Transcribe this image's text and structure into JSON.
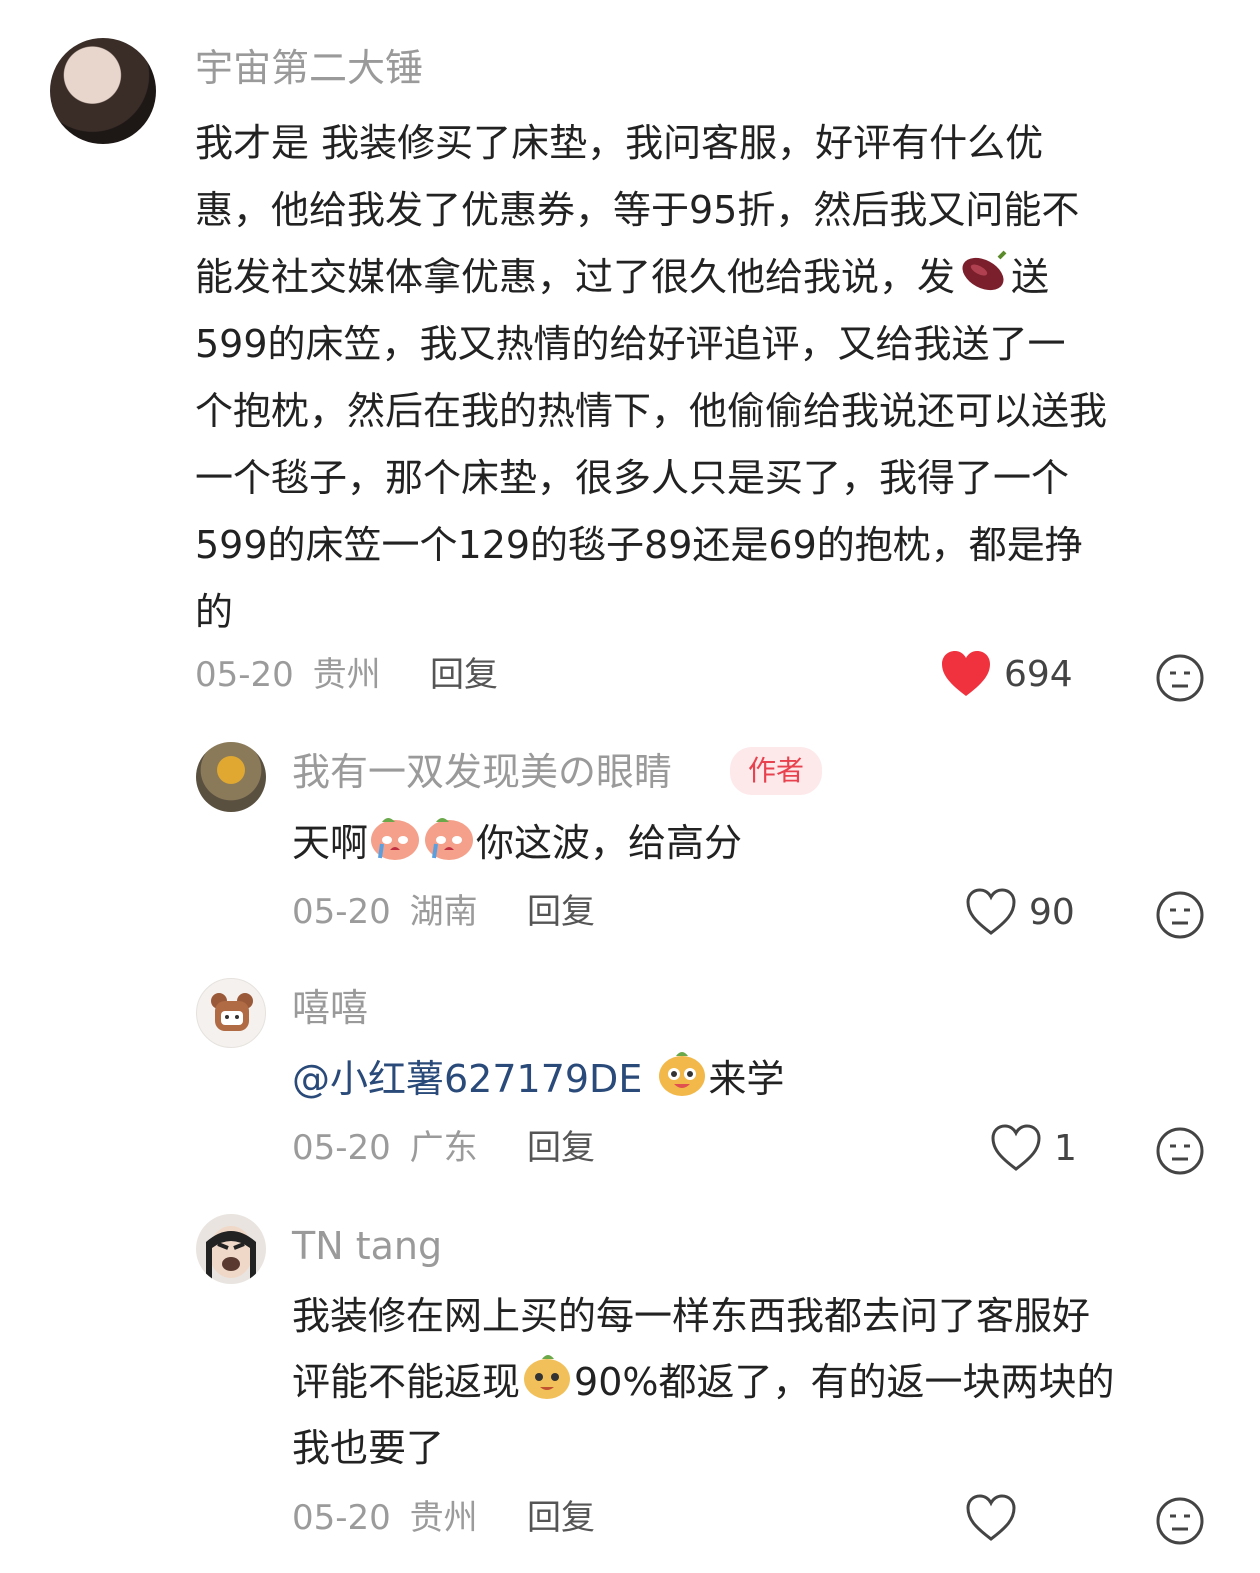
{
  "comments": [
    {
      "username": "宇宙第二大锤",
      "lines": [
        "我才是 我装修买了床垫，我问客服，好评有什么优",
        "惠，他给我发了优惠券，等于95折，然后我又问能不",
        "能发社交媒体拿优惠，过了很久他给我说，发",
        "599的床笠，我又热情的给好评追评，又给我送了一",
        "个抱枕，然后在我的热情下，他偷偷给我说还可以送我",
        "一个毯子，那个床垫，很多人只是买了，我得了一个",
        "599的床笠一个129的毯子89还是69的抱枕，都是挣",
        "的"
      ],
      "line3_tail": "送",
      "date": "05-20",
      "location": "贵州",
      "reply_label": "回复",
      "likes": "694",
      "liked": true
    },
    {
      "username": "我有一双发现美の眼睛",
      "badge": "作者",
      "text_before": "天啊",
      "text_after": "你这波，给高分",
      "date": "05-20",
      "location": "湖南",
      "reply_label": "回复",
      "likes": "90",
      "liked": false
    },
    {
      "username": "嘻嘻",
      "mention": "@小红薯627179DE",
      "text_after": "来学",
      "date": "05-20",
      "location": "广东",
      "reply_label": "回复",
      "likes": "1",
      "liked": false
    },
    {
      "username": "TN tang",
      "line1": "我装修在网上买的每一样东西我都去问了客服好",
      "line2_before": "评能不能返现",
      "line2_after": "90%都返了，有的返一块两块的",
      "line3": "我也要了",
      "date": "05-20",
      "location": "贵州",
      "reply_label": "回复",
      "likes": "",
      "liked": false
    }
  ],
  "colors": {
    "like_red": "#f0323e",
    "muted": "#9b9b9b",
    "mention": "#2a4a7a",
    "badge_bg": "#fde8ea",
    "badge_text": "#e8424f"
  },
  "icons": [
    "heart-icon",
    "dislike-face-icon",
    "sweet-potato-emoji",
    "crying-emoji",
    "happy-emoji"
  ]
}
